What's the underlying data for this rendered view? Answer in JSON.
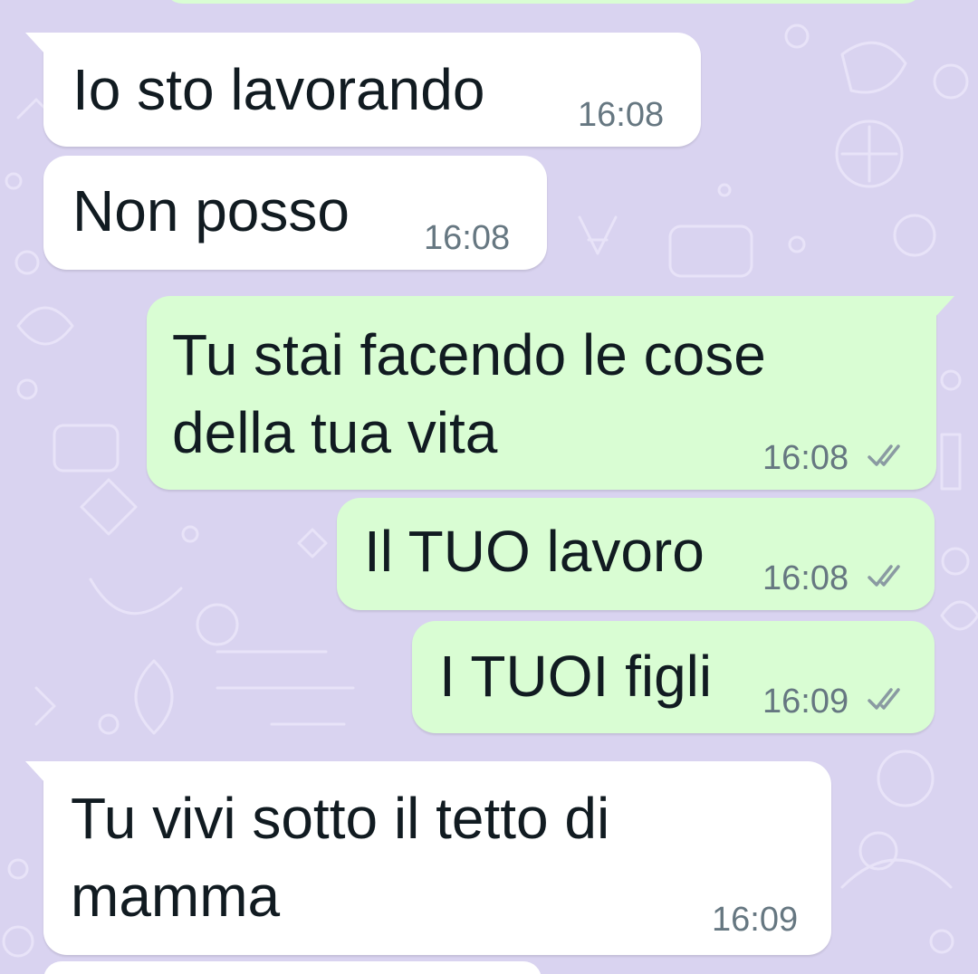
{
  "theme": {
    "wallpaper_color": "#d9d3f0",
    "incoming_bubble_color": "#ffffff",
    "outgoing_bubble_color": "#d9fdd3",
    "timestamp_color": "#667781",
    "tick_color": "#8a9aa2"
  },
  "messages": [
    {
      "direction": "incoming",
      "text": "Io sto lavorando",
      "time": "16:08"
    },
    {
      "direction": "incoming",
      "text": "Non posso",
      "time": "16:08"
    },
    {
      "direction": "outgoing",
      "lines": [
        "Tu stai facendo le cose",
        "della tua vita"
      ],
      "time": "16:08",
      "status_icon": "double-check-icon"
    },
    {
      "direction": "outgoing",
      "text": "Il TUO lavoro",
      "time": "16:08",
      "status_icon": "double-check-icon"
    },
    {
      "direction": "outgoing",
      "text": "I TUOI figli",
      "time": "16:09",
      "status_icon": "double-check-icon"
    },
    {
      "direction": "incoming",
      "lines": [
        "Tu vivi sotto il tetto di",
        "mamma"
      ],
      "time": "16:09"
    }
  ]
}
